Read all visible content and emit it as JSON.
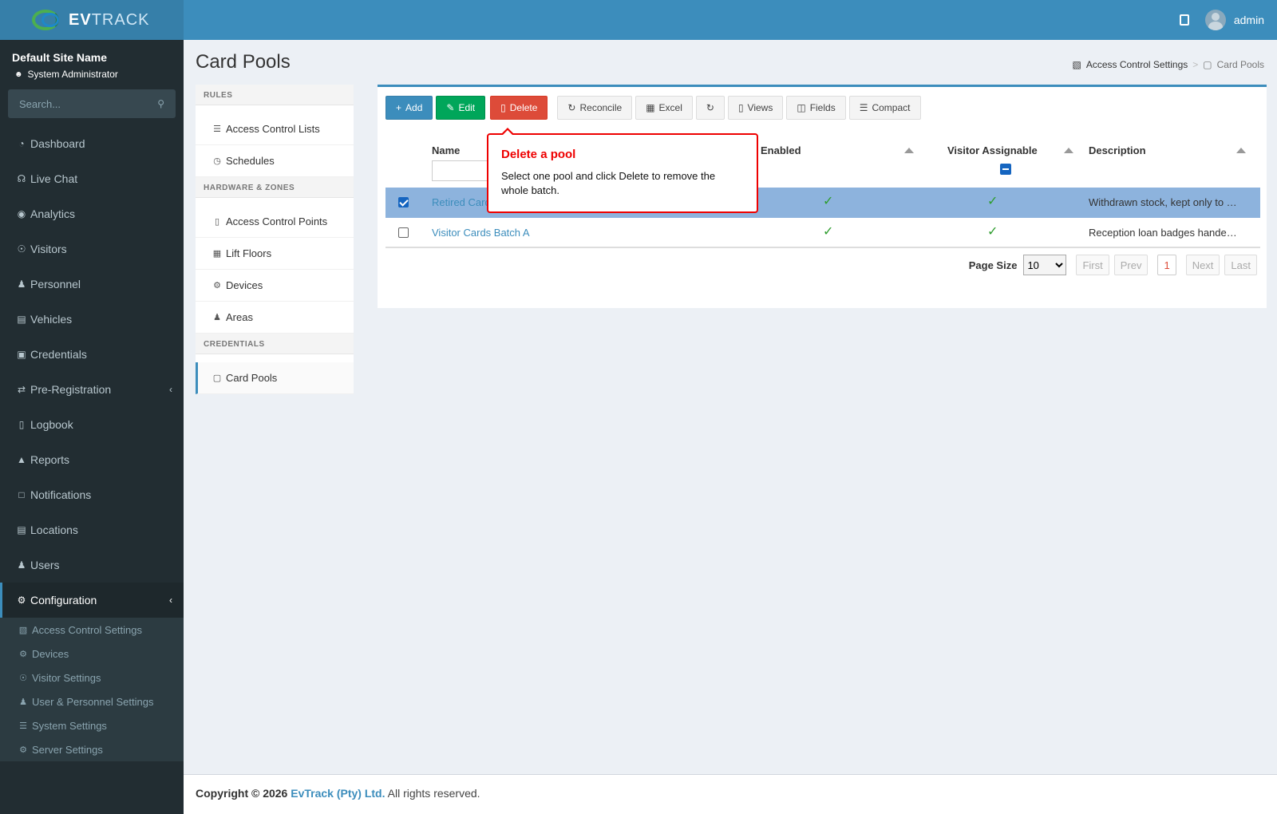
{
  "header": {
    "logo_bold": "EV",
    "logo_light": "TRACK",
    "user": "admin"
  },
  "sidebar": {
    "site_name": "Default Site Name",
    "role": "System Administrator",
    "search_placeholder": "Search...",
    "items": [
      {
        "label": "Dashboard",
        "icon": "dashboard-icon"
      },
      {
        "label": "Live Chat",
        "icon": "headset-icon"
      },
      {
        "label": "Analytics",
        "icon": "target-icon"
      },
      {
        "label": "Visitors",
        "icon": "eye-icon"
      },
      {
        "label": "Personnel",
        "icon": "user-tie-icon"
      },
      {
        "label": "Vehicles",
        "icon": "car-icon"
      },
      {
        "label": "Credentials",
        "icon": "id-card-icon"
      },
      {
        "label": "Pre-Registration",
        "icon": "exchange-icon"
      },
      {
        "label": "Logbook",
        "icon": "book-icon"
      },
      {
        "label": "Reports",
        "icon": "chart-icon"
      },
      {
        "label": "Notifications",
        "icon": "chat-icon"
      },
      {
        "label": "Locations",
        "icon": "map-icon"
      },
      {
        "label": "Users",
        "icon": "users-icon"
      },
      {
        "label": "Configuration",
        "icon": "gear-icon"
      }
    ],
    "subitems": [
      {
        "label": "Access Control Settings",
        "icon": "lock-icon"
      },
      {
        "label": "Devices",
        "icon": "gear-icon"
      },
      {
        "label": "Visitor Settings",
        "icon": "eye-icon"
      },
      {
        "label": "User & Personnel Settings",
        "icon": "user-gear-icon"
      },
      {
        "label": "System Settings",
        "icon": "sliders-icon"
      },
      {
        "label": "Server Settings",
        "icon": "server-icon"
      }
    ]
  },
  "page": {
    "title": "Card Pools",
    "breadcrumb": [
      "Access Control Settings",
      "Card Pools"
    ]
  },
  "settings_menu": {
    "rules_header": "RULES",
    "rules": [
      "Access Control Lists",
      "Schedules"
    ],
    "hardware_header": "HARDWARE & ZONES",
    "hardware": [
      "Access Control Points",
      "Lift Floors",
      "Devices",
      "Areas"
    ],
    "credentials_header": "CREDENTIALS",
    "credentials": [
      "Card Pools"
    ]
  },
  "toolbar": {
    "add": "Add",
    "edit": "Edit",
    "delete": "Delete",
    "reconcile": "Reconcile",
    "excel": "Excel",
    "views": "Views",
    "fields": "Fields",
    "compact": "Compact"
  },
  "grid": {
    "columns": [
      "Name",
      "Enabled",
      "Visitor Assignable",
      "Description"
    ],
    "rows": [
      {
        "name": "Retired Cards",
        "enabled": true,
        "visitor_assignable": true,
        "description": "Withdrawn stock, kept only to …",
        "selected": true
      },
      {
        "name": "Visitor Cards Batch A",
        "enabled": true,
        "visitor_assignable": true,
        "description": "Reception loan badges hande…",
        "selected": false
      }
    ]
  },
  "pager": {
    "label": "Page Size",
    "size": "10",
    "first": "First",
    "prev": "Prev",
    "current": "1",
    "next": "Next",
    "last": "Last"
  },
  "tooltip": {
    "title": "Delete a pool",
    "body": "Select one pool and click Delete to remove the whole batch."
  },
  "footer": {
    "copyright": "Copyright © 2026",
    "company": "EvTrack (Pty) Ltd.",
    "rights": "All rights reserved."
  }
}
